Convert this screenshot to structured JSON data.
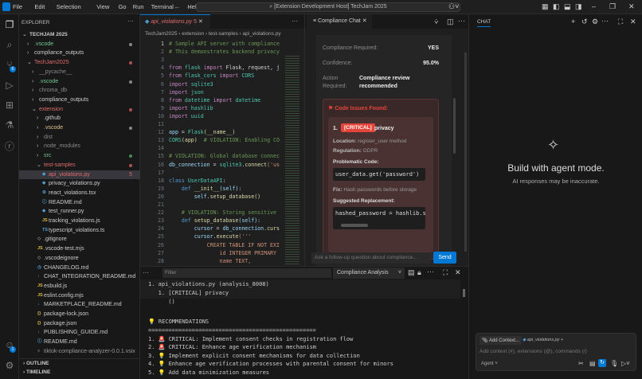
{
  "titlebar": {
    "menus": [
      "File",
      "Edit",
      "Selection",
      "View",
      "Go",
      "Run",
      "Terminal",
      "Help"
    ],
    "title": "[Extension Development Host] TechJam 2025"
  },
  "activity": {
    "scm_badge": "6",
    "accounts_badge": "1"
  },
  "explorer": {
    "header": "EXPLORER",
    "items": [
      {
        "label": "TECHJAM 2025",
        "depth": 0,
        "chev": "v",
        "color": "#ccc",
        "bold": true
      },
      {
        "label": ".vscode",
        "depth": 1,
        "chev": ">",
        "color": "#73c991",
        "dot": "#888"
      },
      {
        "label": "compliance_outputs",
        "depth": 1,
        "chev": ">",
        "color": "#ccc"
      },
      {
        "label": "TechJam2025",
        "depth": 1,
        "chev": "v",
        "color": "#e06c6c",
        "dot": "#b05050"
      },
      {
        "label": "__pycache__",
        "depth": 2,
        "chev": ">",
        "color": "#888"
      },
      {
        "label": ".vscode",
        "depth": 2,
        "chev": ">",
        "color": "#73c991",
        "dot": "#888"
      },
      {
        "label": "chroma_db",
        "depth": 2,
        "chev": ">",
        "color": "#888"
      },
      {
        "label": "compliance_outputs",
        "depth": 2,
        "chev": ">",
        "color": "#ccc"
      },
      {
        "label": "extension",
        "depth": 2,
        "chev": "v",
        "color": "#e06c6c",
        "dot": "#b05050"
      },
      {
        "label": ".github",
        "depth": 3,
        "chev": ">",
        "color": "#ccc"
      },
      {
        "label": ".vscode",
        "depth": 3,
        "chev": ">",
        "color": "#e2c08d",
        "dot": "#888"
      },
      {
        "label": "dist",
        "depth": 3,
        "chev": ">",
        "color": "#888"
      },
      {
        "label": "node_modules",
        "depth": 3,
        "chev": ">",
        "color": "#888"
      },
      {
        "label": "src",
        "depth": 3,
        "chev": ">",
        "color": "#73c991",
        "dot": "#4a8a5a"
      },
      {
        "label": "test-samples",
        "depth": 3,
        "chev": "v",
        "color": "#e06c6c",
        "dot": "#b05050"
      },
      {
        "label": "api_violations.py",
        "depth": 4,
        "icon": "◆",
        "iconColor": "#4f9fd6",
        "color": "#e06c6c",
        "badge": "5",
        "selected": true
      },
      {
        "label": "privacy_violations.py",
        "depth": 4,
        "icon": "◆",
        "iconColor": "#4f9fd6",
        "color": "#ccc"
      },
      {
        "label": "react_violations.tsx",
        "depth": 4,
        "icon": "⚙",
        "iconColor": "#4f9fd6",
        "color": "#ccc"
      },
      {
        "label": "README.md",
        "depth": 4,
        "icon": "ⓘ",
        "iconColor": "#4f9fd6",
        "color": "#ccc"
      },
      {
        "label": "test_runner.py",
        "depth": 4,
        "icon": "◆",
        "iconColor": "#4f9fd6",
        "color": "#ccc"
      },
      {
        "label": "tracking_violations.js",
        "depth": 4,
        "icon": "JS",
        "iconColor": "#d7ba3d",
        "color": "#ccc"
      },
      {
        "label": "typescript_violations.ts",
        "depth": 4,
        "icon": "TS",
        "iconColor": "#4f9fd6",
        "color": "#ccc"
      },
      {
        "label": ".gitignore",
        "depth": 3,
        "icon": "◇",
        "iconColor": "#888",
        "color": "#ccc"
      },
      {
        "label": ".vscode-test.mjs",
        "depth": 3,
        "icon": "JS",
        "iconColor": "#d7ba3d",
        "color": "#ccc"
      },
      {
        "label": ".vscodeignore",
        "depth": 3,
        "icon": "◇",
        "iconColor": "#888",
        "color": "#ccc"
      },
      {
        "label": "CHANGELOG.md",
        "depth": 3,
        "icon": "◷",
        "iconColor": "#4f9fd6",
        "color": "#ccc"
      },
      {
        "label": "CHAT_INTEGRATION_README.md",
        "depth": 3,
        "icon": "↓",
        "iconColor": "#4f9fd6",
        "color": "#ccc"
      },
      {
        "label": "esbuild.js",
        "depth": 3,
        "icon": "JS",
        "iconColor": "#d7ba3d",
        "color": "#ccc"
      },
      {
        "label": "eslint.config.mjs",
        "depth": 3,
        "icon": "JS",
        "iconColor": "#d7ba3d",
        "color": "#ccc"
      },
      {
        "label": "MARKETPLACE_README.md",
        "depth": 3,
        "icon": "↓",
        "iconColor": "#4f9fd6",
        "color": "#ccc"
      },
      {
        "label": "package-lock.json",
        "depth": 3,
        "icon": "{}",
        "iconColor": "#d7ba3d",
        "color": "#ccc"
      },
      {
        "label": "package.json",
        "depth": 3,
        "icon": "{}",
        "iconColor": "#d7ba3d",
        "color": "#ccc"
      },
      {
        "label": "PUBLISHING_GUIDE.md",
        "depth": 3,
        "icon": "↓",
        "iconColor": "#4f9fd6",
        "color": "#ccc"
      },
      {
        "label": "README.md",
        "depth": 3,
        "icon": "ⓘ",
        "iconColor": "#4f9fd6",
        "color": "#ccc"
      },
      {
        "label": "tiktok-compliance-analyzer-0.0.1.vsix",
        "depth": 3,
        "icon": "≡",
        "iconColor": "#888",
        "color": "#999"
      }
    ],
    "outline": "OUTLINE",
    "timeline": "TIMELINE"
  },
  "editor": {
    "tab": {
      "label": "api_violations.py",
      "badge": "5"
    },
    "breadcrumb": [
      "TechJam2025",
      "extension",
      "test-samples",
      "api_violations.py"
    ],
    "lines": [
      [
        [
          "# Sample API server with compliance",
          "cm"
        ]
      ],
      [
        [
          "# This demonstrates backend privacy",
          "cm"
        ]
      ],
      [],
      [
        [
          "from ",
          "kw"
        ],
        [
          "flask",
          "cls"
        ],
        [
          " import ",
          "kw"
        ],
        [
          "Flask, request, j",
          "pl"
        ]
      ],
      [
        [
          "from ",
          "kw"
        ],
        [
          "flask_cors",
          "cls"
        ],
        [
          " import ",
          "kw"
        ],
        [
          "CORS",
          "cls"
        ]
      ],
      [
        [
          "import ",
          "kw"
        ],
        [
          "sqlite3",
          "cls"
        ]
      ],
      [
        [
          "import ",
          "kw"
        ],
        [
          "json",
          "cls"
        ]
      ],
      [
        [
          "from ",
          "kw"
        ],
        [
          "datetime",
          "cls"
        ],
        [
          " import ",
          "kw"
        ],
        [
          "datetime",
          "cls"
        ]
      ],
      [
        [
          "import ",
          "kw"
        ],
        [
          "hashlib",
          "cls"
        ]
      ],
      [
        [
          "import ",
          "kw"
        ],
        [
          "uuid",
          "cls"
        ]
      ],
      [],
      [
        [
          "app",
          "vr"
        ],
        [
          " = ",
          "pl"
        ],
        [
          "Flask",
          "cls"
        ],
        [
          "(__name__)",
          "fn"
        ]
      ],
      [
        [
          "CORS",
          "cls"
        ],
        [
          "(app)",
          "fn"
        ],
        [
          "  # VIOLATION: Enabling CO",
          "cm"
        ]
      ],
      [],
      [
        [
          "# VIOLATION: Global database connec",
          "cm"
        ]
      ],
      [
        [
          "db_connection",
          "vr"
        ],
        [
          " = ",
          "pl"
        ],
        [
          "sqlite3",
          "cls"
        ],
        [
          ".",
          "pl"
        ],
        [
          "connect",
          "fn"
        ],
        [
          "('us",
          "st"
        ]
      ],
      [],
      [
        [
          "class ",
          "df"
        ],
        [
          "UserDataAPI",
          "cls"
        ],
        [
          ":",
          "pl"
        ]
      ],
      [
        [
          "    def ",
          "df"
        ],
        [
          "__init__",
          "fn"
        ],
        [
          "(self):",
          "vr"
        ]
      ],
      [
        [
          "        self",
          "vr"
        ],
        [
          ".",
          "pl"
        ],
        [
          "setup_database",
          "fn"
        ],
        [
          "()",
          "fn"
        ]
      ],
      [],
      [
        [
          "    # VIOLATION: Storing sensitive",
          "cm"
        ]
      ],
      [
        [
          "    def ",
          "df"
        ],
        [
          "setup_database",
          "fn"
        ],
        [
          "(self):",
          "vr"
        ]
      ],
      [
        [
          "        cursor",
          "vr"
        ],
        [
          " = ",
          "pl"
        ],
        [
          "db_connection",
          "vr"
        ],
        [
          ".curs",
          "fn"
        ]
      ],
      [
        [
          "        cursor",
          "vr"
        ],
        [
          ".",
          "pl"
        ],
        [
          "execute",
          "fn"
        ],
        [
          "('''",
          "st"
        ]
      ],
      [
        [
          "            CREATE TABLE IF NOT EXI",
          "st"
        ]
      ],
      [
        [
          "                id INTEGER PRIMARY",
          "st"
        ]
      ],
      [
        [
          "                name TEXT,",
          "st"
        ]
      ]
    ]
  },
  "compliance": {
    "tab": "Compliance Chat",
    "rows": [
      {
        "label": "Compliance Required:",
        "value": "YES"
      },
      {
        "label": "Confidence:",
        "value": "95.0%"
      }
    ],
    "action_label_1": "Action",
    "action_label_2": "Required:",
    "action_value_1": "Compliance review",
    "action_value_2": "recommended",
    "issues_title": "Code Issues Found:",
    "issue": {
      "num": "1.",
      "severity": "[CRITICAL]",
      "category": "privacy",
      "location_label": "Location:",
      "location": "register_user method",
      "regulation_label": "Regulation:",
      "regulation": "GDPR",
      "problem_label": "Problematic Code:",
      "problem_code": "user_data.get('password')",
      "fix_label": "Fix:",
      "fix": "Hash passwords before storage",
      "replacement_label": "Suggested Replacement:",
      "replacement_code": "hashed_password = hashlib.sh"
    },
    "input_placeholder": "Ask a follow-up question about compliance...",
    "send": "Send",
    "accent": "#0078d4",
    "critical": "#e5443a"
  },
  "panel": {
    "filter_placeholder": "Filter",
    "dropdown": "Compliance Analysis",
    "output": [
      "1. api_violations.py (analysis_8008)",
      "   1. [CRITICAL] privacy",
      "      ()",
      "",
      "💡 RECOMMENDATIONS",
      "==================================================",
      "1. 🚨 CRITICAL: Implement consent checks in registration flow",
      "2. 🚨 CRITICAL: Enhance age verification mechanism",
      "3. 💡 Implement explicit consent mechanisms for data collection",
      "4. 💡 Enhance age verification processes with parental consent for minors",
      "5. 💡 Add data minimization measures"
    ]
  },
  "chat": {
    "tab": "CHAT",
    "heading": "Build with agent mode.",
    "sub": "AI responses may be inaccurate.",
    "add_context": "Add Context...",
    "file_chip": "api_violations.py",
    "placeholder": "Add context (#), extensions (@), commands (/)",
    "mode": "Agent"
  }
}
